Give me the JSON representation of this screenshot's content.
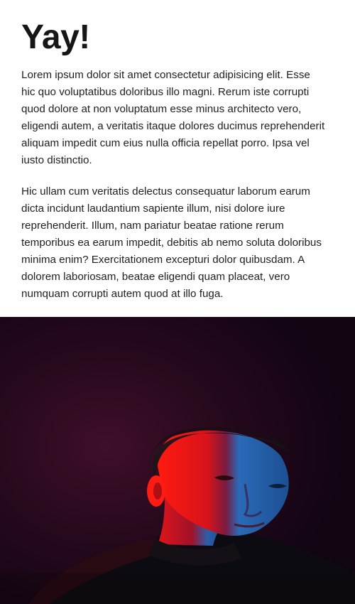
{
  "page": {
    "title": "Yay!",
    "paragraphs": [
      "Lorem ipsum dolor sit amet consectetur adipisicing elit. Esse hic quo voluptatibus doloribus illo magni. Rerum iste corrupti quod dolore at non voluptatum esse minus architecto vero, eligendi autem, a veritatis itaque dolores ducimus reprehenderit aliquam impedit cum eius nulla officia repellat porro. Ipsa vel iusto distinctio.",
      "Hic ullam cum veritatis delectus consequatur laborum earum dicta incidunt laudantium sapiente illum, nisi dolore iure reprehenderit. Illum, nam pariatur beatae ratione rerum temporibus ea earum impedit, debitis ab nemo soluta doloribus minima enim? Exercitationem excepturi dolor quibusdam. A dolorem laboriosam, beatae eligendi quam placeat, vero numquam corrupti autem quod at illo fuga."
    ]
  },
  "colors": {
    "background": "#ffffff",
    "text": "#1a1a1a",
    "photo_background": "#2a0a1f",
    "red_light": "#e0101a",
    "blue_light": "#1f5fb0"
  },
  "icons": {
    "photo": "portrait-photo"
  }
}
